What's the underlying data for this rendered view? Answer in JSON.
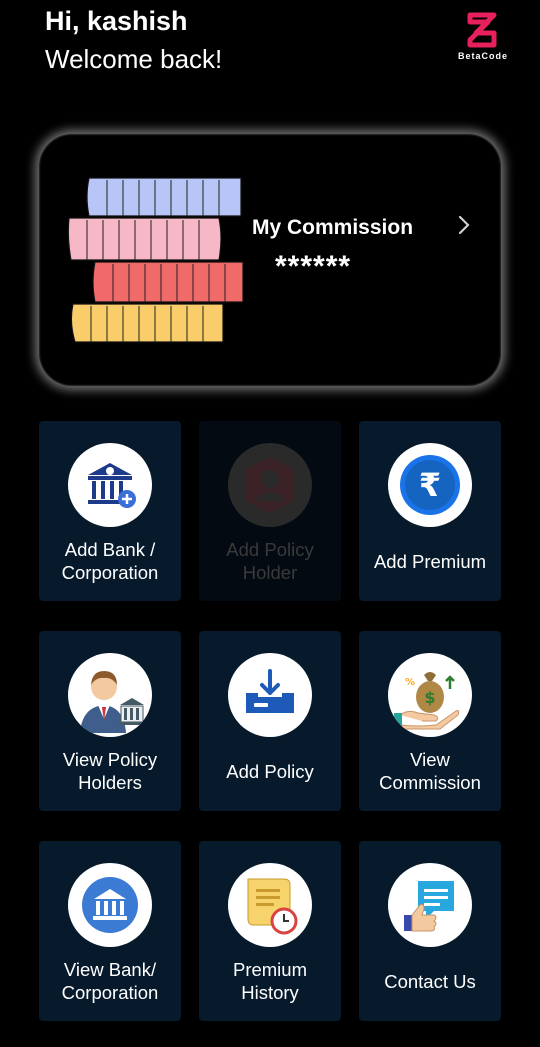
{
  "header": {
    "greeting": "Hi, kashish",
    "subtitle": "Welcome back!",
    "logo_text": "BetaCode",
    "logo_color": "#e8205c"
  },
  "commission": {
    "title": "My Commission",
    "value": "******"
  },
  "tiles": [
    {
      "label": "Add Bank / Corporation",
      "icon": "bank-add-icon",
      "enabled": true
    },
    {
      "label": "Add Policy Holder",
      "icon": "user-avatar-icon",
      "enabled": false
    },
    {
      "label": "Add Premium",
      "icon": "rupee-icon",
      "enabled": true
    },
    {
      "label": "View Policy Holders",
      "icon": "businessman-icon",
      "enabled": true
    },
    {
      "label": "Add Policy",
      "icon": "inbox-download-icon",
      "enabled": true
    },
    {
      "label": "View Commission",
      "icon": "money-bag-icon",
      "enabled": true
    },
    {
      "label": "View Bank/ Corporation",
      "icon": "bank-icon",
      "enabled": true
    },
    {
      "label": "Premium History",
      "icon": "scroll-clock-icon",
      "enabled": true
    },
    {
      "label": "Contact Us",
      "icon": "thumbs-up-chat-icon",
      "enabled": true
    }
  ]
}
